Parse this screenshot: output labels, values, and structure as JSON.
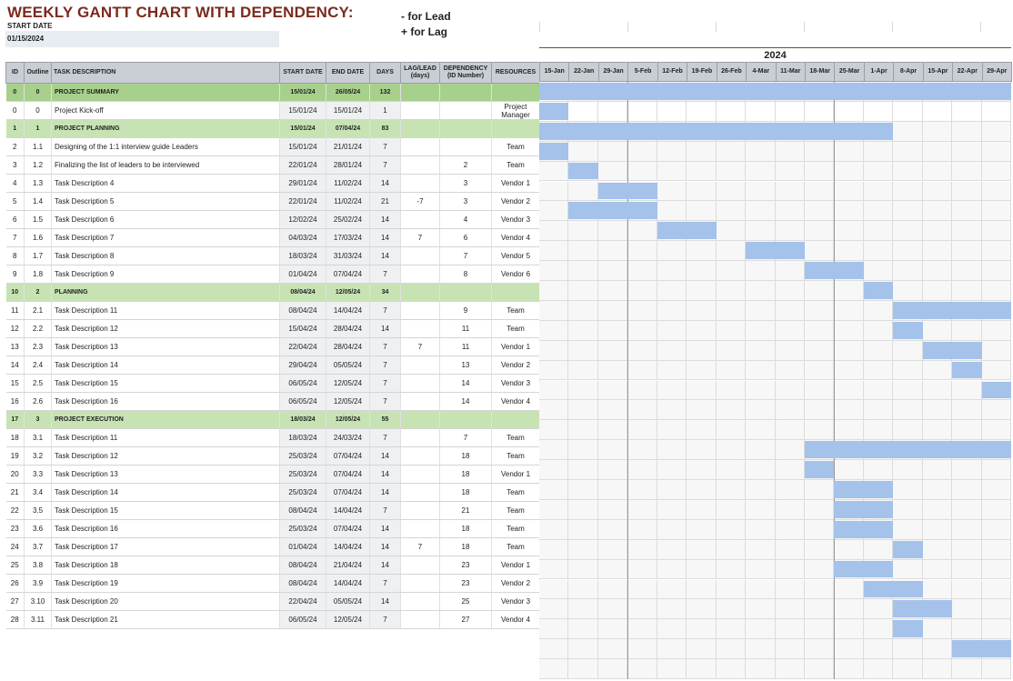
{
  "header": {
    "title": "WEEKLY GANTT CHART WITH DEPENDENCY:",
    "start_date_label": "START DATE",
    "start_date_value": "01/15/2024",
    "legend_lead": "- for Lead",
    "legend_lag": "+ for Lag",
    "year": "2024"
  },
  "columns": {
    "id": "ID",
    "outline": "Outline",
    "desc": "TASK DESCRIPTION",
    "start": "START DATE",
    "end": "END DATE",
    "days": "DAYS",
    "lag": "LAG/LEAD (days)",
    "dep": "DEPENDENCY (ID Number)",
    "res": "RESOURCES"
  },
  "weeks": [
    "15-Jan",
    "22-Jan",
    "29-Jan",
    "5-Feb",
    "12-Feb",
    "19-Feb",
    "26-Feb",
    "4-Mar",
    "11-Mar",
    "18-Mar",
    "25-Mar",
    "1-Apr",
    "8-Apr",
    "15-Apr",
    "22-Apr",
    "29-Apr"
  ],
  "week_line_after": [
    2,
    9
  ],
  "rows": [
    {
      "id": "0",
      "outline": "0",
      "desc": "PROJECT SUMMARY",
      "start": "15/01/24",
      "end": "26/05/24",
      "days": "132",
      "lag": "",
      "dep": "",
      "res": "",
      "type": "summary",
      "bar_start": 0,
      "bar_weeks": 16
    },
    {
      "id": "0",
      "outline": "0",
      "desc": "Project Kick-off",
      "start": "15/01/24",
      "end": "15/01/24",
      "days": "1",
      "lag": "",
      "dep": "",
      "res": "Project Manager",
      "type": "task",
      "bar_start": 0,
      "bar_weeks": 1
    },
    {
      "id": "1",
      "outline": "1",
      "desc": "PROJECT PLANNING",
      "start": "15/01/24",
      "end": "07/04/24",
      "days": "83",
      "lag": "",
      "dep": "",
      "res": "",
      "type": "phase",
      "bar_start": 0,
      "bar_weeks": 12
    },
    {
      "id": "2",
      "outline": "1.1",
      "desc": "Designing of the 1:1 interview guide Leaders",
      "start": "15/01/24",
      "end": "21/01/24",
      "days": "7",
      "lag": "",
      "dep": "",
      "res": "Team",
      "type": "task",
      "bar_start": 0,
      "bar_weeks": 1
    },
    {
      "id": "3",
      "outline": "1.2",
      "desc": "Finalizing the list of leaders to be interviewed",
      "start": "22/01/24",
      "end": "28/01/24",
      "days": "7",
      "lag": "",
      "dep": "2",
      "res": "Team",
      "type": "task",
      "bar_start": 1,
      "bar_weeks": 1
    },
    {
      "id": "4",
      "outline": "1.3",
      "desc": "Task Description 4",
      "start": "29/01/24",
      "end": "11/02/24",
      "days": "14",
      "lag": "",
      "dep": "3",
      "res": "Vendor 1",
      "type": "task",
      "bar_start": 2,
      "bar_weeks": 2
    },
    {
      "id": "5",
      "outline": "1.4",
      "desc": "Task Description 5",
      "start": "22/01/24",
      "end": "11/02/24",
      "days": "21",
      "lag": "-7",
      "dep": "3",
      "res": "Vendor 2",
      "type": "task",
      "bar_start": 1,
      "bar_weeks": 3
    },
    {
      "id": "6",
      "outline": "1.5",
      "desc": "Task Description 6",
      "start": "12/02/24",
      "end": "25/02/24",
      "days": "14",
      "lag": "",
      "dep": "4",
      "res": "Vendor 3",
      "type": "task",
      "bar_start": 4,
      "bar_weeks": 2
    },
    {
      "id": "7",
      "outline": "1.6",
      "desc": "Task Description 7",
      "start": "04/03/24",
      "end": "17/03/24",
      "days": "14",
      "lag": "7",
      "dep": "6",
      "res": "Vendor 4",
      "type": "task",
      "bar_start": 7,
      "bar_weeks": 2
    },
    {
      "id": "8",
      "outline": "1.7",
      "desc": "Task Description 8",
      "start": "18/03/24",
      "end": "31/03/24",
      "days": "14",
      "lag": "",
      "dep": "7",
      "res": "Vendor 5",
      "type": "task",
      "bar_start": 9,
      "bar_weeks": 2
    },
    {
      "id": "9",
      "outline": "1.8",
      "desc": "Task Description 9",
      "start": "01/04/24",
      "end": "07/04/24",
      "days": "7",
      "lag": "",
      "dep": "8",
      "res": "Vendor 6",
      "type": "task",
      "bar_start": 11,
      "bar_weeks": 1
    },
    {
      "id": "10",
      "outline": "2",
      "desc": "PLANNING",
      "start": "08/04/24",
      "end": "12/05/24",
      "days": "34",
      "lag": "",
      "dep": "",
      "res": "",
      "type": "phase",
      "bar_start": 12,
      "bar_weeks": 4
    },
    {
      "id": "11",
      "outline": "2.1",
      "desc": "Task Description 11",
      "start": "08/04/24",
      "end": "14/04/24",
      "days": "7",
      "lag": "",
      "dep": "9",
      "res": "Team",
      "type": "task",
      "bar_start": 12,
      "bar_weeks": 1
    },
    {
      "id": "12",
      "outline": "2.2",
      "desc": "Task Description 12",
      "start": "15/04/24",
      "end": "28/04/24",
      "days": "14",
      "lag": "",
      "dep": "11",
      "res": "Team",
      "type": "task",
      "bar_start": 13,
      "bar_weeks": 2
    },
    {
      "id": "13",
      "outline": "2.3",
      "desc": "Task Description 13",
      "start": "22/04/24",
      "end": "28/04/24",
      "days": "7",
      "lag": "7",
      "dep": "11",
      "res": "Vendor 1",
      "type": "task",
      "bar_start": 14,
      "bar_weeks": 1
    },
    {
      "id": "14",
      "outline": "2.4",
      "desc": "Task Description 14",
      "start": "29/04/24",
      "end": "05/05/24",
      "days": "7",
      "lag": "",
      "dep": "13",
      "res": "Vendor 2",
      "type": "task",
      "bar_start": 15,
      "bar_weeks": 1
    },
    {
      "id": "15",
      "outline": "2.5",
      "desc": "Task Description 15",
      "start": "06/05/24",
      "end": "12/05/24",
      "days": "7",
      "lag": "",
      "dep": "14",
      "res": "Vendor 3",
      "type": "task",
      "bar_start": 16,
      "bar_weeks": 0
    },
    {
      "id": "16",
      "outline": "2.6",
      "desc": "Task Description 16",
      "start": "06/05/24",
      "end": "12/05/24",
      "days": "7",
      "lag": "",
      "dep": "14",
      "res": "Vendor 4",
      "type": "task",
      "bar_start": 16,
      "bar_weeks": 0
    },
    {
      "id": "17",
      "outline": "3",
      "desc": "PROJECT EXECUTION",
      "start": "18/03/24",
      "end": "12/05/24",
      "days": "55",
      "lag": "",
      "dep": "",
      "res": "",
      "type": "phase",
      "bar_start": 9,
      "bar_weeks": 7
    },
    {
      "id": "18",
      "outline": "3.1",
      "desc": "Task Description 11",
      "start": "18/03/24",
      "end": "24/03/24",
      "days": "7",
      "lag": "",
      "dep": "7",
      "res": "Team",
      "type": "task",
      "bar_start": 9,
      "bar_weeks": 1
    },
    {
      "id": "19",
      "outline": "3.2",
      "desc": "Task Description 12",
      "start": "25/03/24",
      "end": "07/04/24",
      "days": "14",
      "lag": "",
      "dep": "18",
      "res": "Team",
      "type": "task",
      "bar_start": 10,
      "bar_weeks": 2
    },
    {
      "id": "20",
      "outline": "3.3",
      "desc": "Task Description 13",
      "start": "25/03/24",
      "end": "07/04/24",
      "days": "14",
      "lag": "",
      "dep": "18",
      "res": "Vendor 1",
      "type": "task",
      "bar_start": 10,
      "bar_weeks": 2
    },
    {
      "id": "21",
      "outline": "3.4",
      "desc": "Task Description 14",
      "start": "25/03/24",
      "end": "07/04/24",
      "days": "14",
      "lag": "",
      "dep": "18",
      "res": "Team",
      "type": "task",
      "bar_start": 10,
      "bar_weeks": 2
    },
    {
      "id": "22",
      "outline": "3.5",
      "desc": "Task Description 15",
      "start": "08/04/24",
      "end": "14/04/24",
      "days": "7",
      "lag": "",
      "dep": "21",
      "res": "Team",
      "type": "task",
      "bar_start": 12,
      "bar_weeks": 1
    },
    {
      "id": "23",
      "outline": "3.6",
      "desc": "Task Description 16",
      "start": "25/03/24",
      "end": "07/04/24",
      "days": "14",
      "lag": "",
      "dep": "18",
      "res": "Team",
      "type": "task",
      "bar_start": 10,
      "bar_weeks": 2
    },
    {
      "id": "24",
      "outline": "3.7",
      "desc": "Task Description 17",
      "start": "01/04/24",
      "end": "14/04/24",
      "days": "14",
      "lag": "7",
      "dep": "18",
      "res": "Team",
      "type": "task",
      "bar_start": 11,
      "bar_weeks": 2
    },
    {
      "id": "25",
      "outline": "3.8",
      "desc": "Task Description 18",
      "start": "08/04/24",
      "end": "21/04/24",
      "days": "14",
      "lag": "",
      "dep": "23",
      "res": "Vendor 1",
      "type": "task",
      "bar_start": 12,
      "bar_weeks": 2
    },
    {
      "id": "26",
      "outline": "3.9",
      "desc": "Task Description 19",
      "start": "08/04/24",
      "end": "14/04/24",
      "days": "7",
      "lag": "",
      "dep": "23",
      "res": "Vendor 2",
      "type": "task",
      "bar_start": 12,
      "bar_weeks": 1
    },
    {
      "id": "27",
      "outline": "3.10",
      "desc": "Task Description 20",
      "start": "22/04/24",
      "end": "05/05/24",
      "days": "14",
      "lag": "",
      "dep": "25",
      "res": "Vendor 3",
      "type": "task",
      "bar_start": 14,
      "bar_weeks": 2
    },
    {
      "id": "28",
      "outline": "3.11",
      "desc": "Task Description 21",
      "start": "06/05/24",
      "end": "12/05/24",
      "days": "7",
      "lag": "",
      "dep": "27",
      "res": "Vendor 4",
      "type": "task",
      "bar_start": 16,
      "bar_weeks": 0
    }
  ],
  "colors": {
    "bar": "#a4c2ea",
    "summary_row": "#a8d08d",
    "phase_row": "#c7e3b4",
    "header_bg": "#c9ced4",
    "title": "#7b2a1e"
  }
}
